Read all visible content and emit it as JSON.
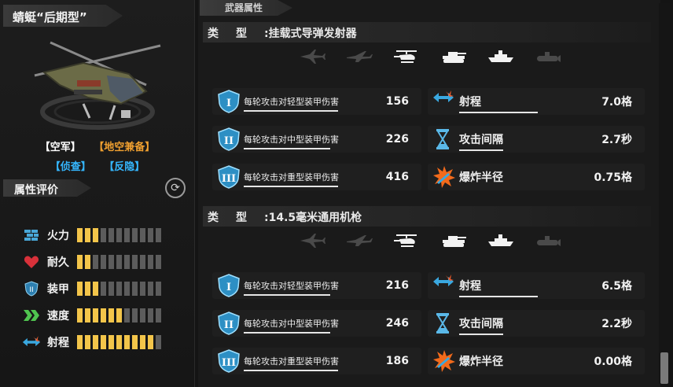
{
  "unit": {
    "name": "蜻蜓“后期型”",
    "tags_row1": [
      "【空军】",
      "【地空兼备】"
    ],
    "tags_row2": [
      "【侦查】",
      "【反隐】"
    ]
  },
  "attributes": {
    "title": "属性评价",
    "max": 11,
    "items": [
      {
        "label": "火力",
        "icon": "firepower-icon",
        "value": 3
      },
      {
        "label": "耐久",
        "icon": "heart-icon",
        "value": 2
      },
      {
        "label": "装甲",
        "icon": "armor-shield-icon",
        "value": 3
      },
      {
        "label": "速度",
        "icon": "speed-chevron-icon",
        "value": 6
      },
      {
        "label": "射程",
        "icon": "range-arrows-icon",
        "value": 10
      }
    ]
  },
  "weapon_section_title": "武器属性",
  "weapons": [
    {
      "type_key": "类型",
      "type_value": ":挂载式导弹发射器",
      "targets": [
        {
          "name": "fighter-jet-icon",
          "active": false
        },
        {
          "name": "bomber-jet-icon",
          "active": false
        },
        {
          "name": "helicopter-icon",
          "active": true
        },
        {
          "name": "tank-icon",
          "active": true
        },
        {
          "name": "ship-icon",
          "active": true
        },
        {
          "name": "submarine-icon",
          "active": false
        }
      ],
      "damage": [
        {
          "label": "每轮攻击对轻型装甲伤害",
          "value": "156",
          "icon": "armor-I-icon"
        },
        {
          "label": "每轮攻击对中型装甲伤害",
          "value": "226",
          "icon": "armor-II-icon"
        },
        {
          "label": "每轮攻击对重型装甲伤害",
          "value": "416",
          "icon": "armor-III-icon"
        }
      ],
      "specs": [
        {
          "label": "射程",
          "value": "7.0格",
          "icon": "range-arrows-icon"
        },
        {
          "label": "攻击间隔",
          "value": "2.7秒",
          "icon": "hourglass-icon"
        },
        {
          "label": "爆炸半径",
          "value": "0.75格",
          "icon": "explosion-icon"
        }
      ]
    },
    {
      "type_key": "类型",
      "type_value": ":14.5毫米通用机枪",
      "targets": [
        {
          "name": "fighter-jet-icon",
          "active": false
        },
        {
          "name": "bomber-jet-icon",
          "active": false
        },
        {
          "name": "helicopter-icon",
          "active": true
        },
        {
          "name": "tank-icon",
          "active": true
        },
        {
          "name": "ship-icon",
          "active": true
        },
        {
          "name": "submarine-icon",
          "active": false
        }
      ],
      "damage": [
        {
          "label": "每轮攻击对轻型装甲伤害",
          "value": "216",
          "icon": "armor-I-icon"
        },
        {
          "label": "每轮攻击对中型装甲伤害",
          "value": "246",
          "icon": "armor-II-icon"
        },
        {
          "label": "每轮攻击对重型装甲伤害",
          "value": "186",
          "icon": "armor-III-icon"
        }
      ],
      "specs": [
        {
          "label": "射程",
          "value": "6.5格",
          "icon": "range-arrows-icon"
        },
        {
          "label": "攻击间隔",
          "value": "2.2秒",
          "icon": "hourglass-icon"
        },
        {
          "label": "爆炸半径",
          "value": "0.00格",
          "icon": "explosion-icon"
        }
      ]
    }
  ],
  "colors": {
    "bar_on": "#f3c54a",
    "bar_off": "#5c5c5c",
    "accent_cyan": "#35b7ff",
    "accent_orange": "#f0a030"
  }
}
